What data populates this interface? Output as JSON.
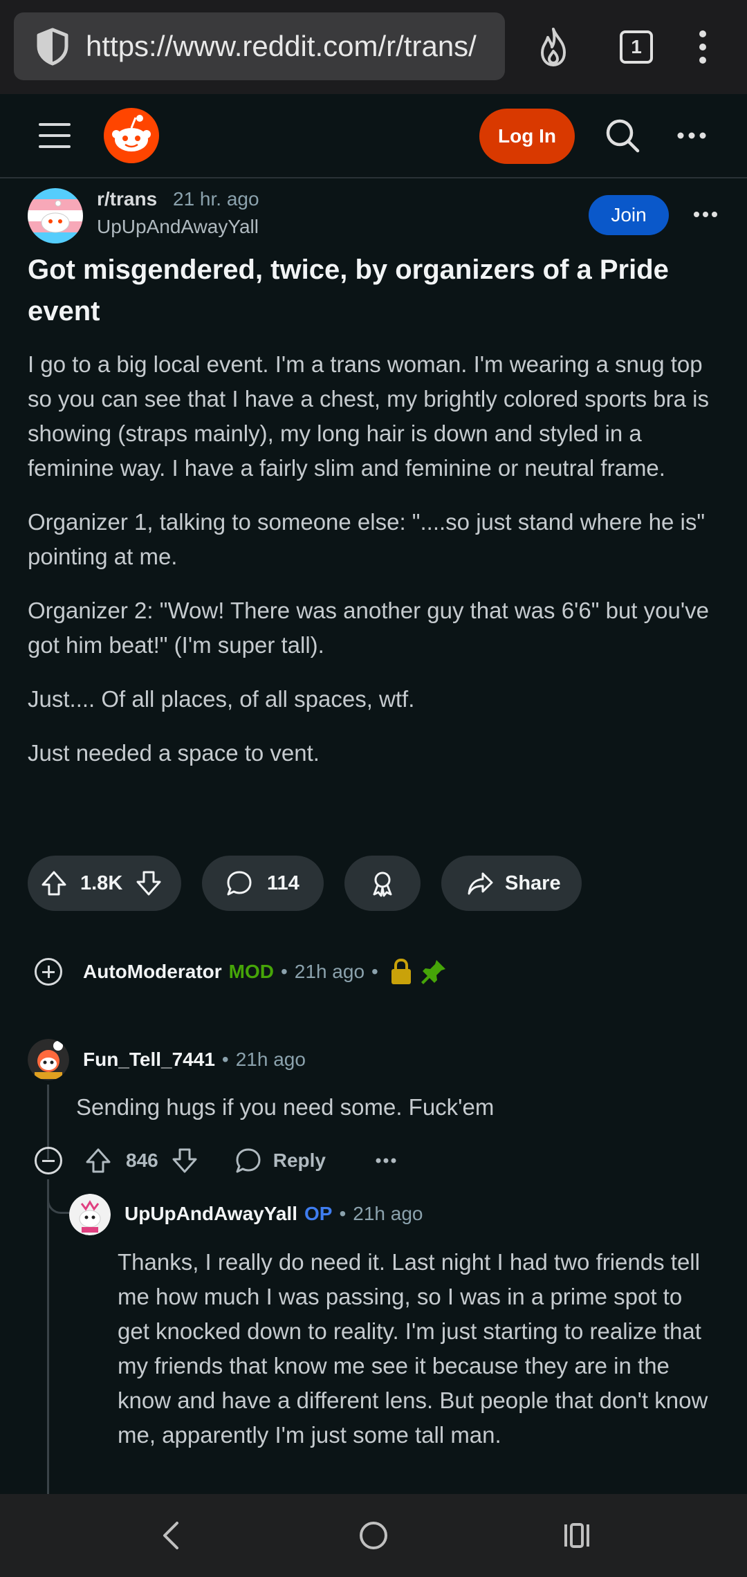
{
  "browser": {
    "url": "https://www.reddit.com/r/trans/",
    "tab_count": "1"
  },
  "header": {
    "login_label": "Log In"
  },
  "post": {
    "subreddit": "r/trans",
    "time": "21 hr. ago",
    "author": "UpUpAndAwayYall",
    "join_label": "Join",
    "title": "Got misgendered, twice, by organizers of a Pride event",
    "paragraphs": [
      "I go to a big local event. I'm a trans woman. I'm wearing a snug top so you can see that I have a chest, my brightly colored sports bra is showing (straps mainly), my long hair is down and styled in a feminine way. I have a fairly slim and feminine or neutral frame.",
      "Organizer 1, talking to someone else: \"....so just stand where he is\" pointing at me.",
      "Organizer 2: \"Wow! There was another guy that was 6'6\" but you've got him beat!\" (I'm super tall).",
      "Just.... Of all places, of all spaces, wtf.",
      "Just needed a space to vent."
    ],
    "votes": "1.8K",
    "comments": "114",
    "share_label": "Share"
  },
  "automod": {
    "name": "AutoModerator",
    "badge": "MOD",
    "time": "21h ago"
  },
  "comment1": {
    "author": "Fun_Tell_7441",
    "time": "21h ago",
    "text": "Sending hugs if you need some. Fuck'em",
    "votes": "846",
    "reply_label": "Reply"
  },
  "reply1": {
    "author": "UpUpAndAwayYall",
    "badge": "OP",
    "time": "21h ago",
    "text": "Thanks, I really do need it. Last night I had two friends tell me how much I was passing, so I was in a prime spot to get knocked down to reality. I'm just starting to realize that my friends that know me see it because they are in the know and have a different lens. But people that don't know me, apparently I'm just some tall man."
  },
  "colors": {
    "background": "#0b1416",
    "reddit_orange": "#d93900",
    "join_blue": "#0a58ca",
    "mod_green": "#46a508",
    "op_blue": "#3f7df0"
  }
}
